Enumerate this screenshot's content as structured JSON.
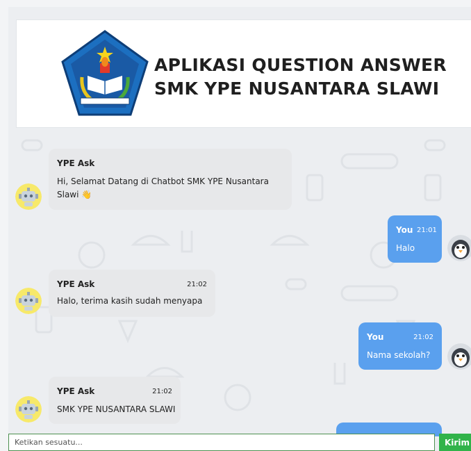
{
  "header": {
    "title_line1": "APLIKASI QUESTION ANSWER",
    "title_line2": "SMK YPE NUSANTARA SLAWI",
    "logo_icon": "school-crest-icon"
  },
  "messages": [
    {
      "from": "bot",
      "sender": "YPE Ask",
      "time": "",
      "text": "Hi, Selamat Datang di Chatbot SMK YPE Nusantara Slawi 👋"
    },
    {
      "from": "user",
      "sender": "You",
      "time": "21:01",
      "text": "Halo"
    },
    {
      "from": "bot",
      "sender": "YPE Ask",
      "time": "21:02",
      "text": "Halo, terima kasih sudah menyapa"
    },
    {
      "from": "user",
      "sender": "You",
      "time": "21:02",
      "text": "Nama sekolah?"
    },
    {
      "from": "bot",
      "sender": "YPE Ask",
      "time": "21:02",
      "text": "SMK YPE NUSANTARA SLAWI"
    }
  ],
  "composer": {
    "placeholder": "Ketikan sesuatu...",
    "send_label": "Kirim"
  },
  "colors": {
    "user_bubble": "#5aa0ee",
    "bot_bubble": "#e7e8ea",
    "send_button": "#31b34a",
    "bot_avatar_bg": "#f7e96a"
  }
}
